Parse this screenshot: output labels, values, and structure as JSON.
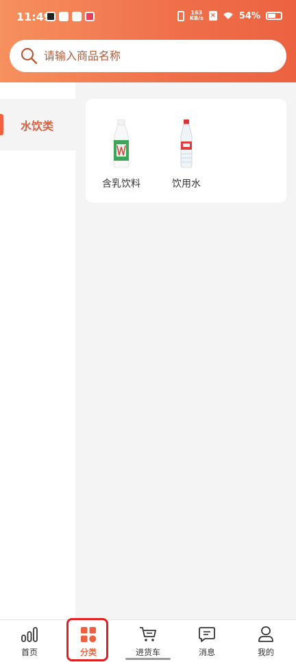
{
  "status_bar": {
    "time": "11:49",
    "network_speed_top": "163",
    "network_speed_unit": "KB/s",
    "battery_percent": "54%"
  },
  "search": {
    "placeholder": "请输入商品名称"
  },
  "sidebar": {
    "items": [
      {
        "label": "水饮类",
        "selected": true
      }
    ]
  },
  "products": [
    {
      "name": "含乳饮料",
      "icon": "milk-drink-bottle"
    },
    {
      "name": "饮用水",
      "icon": "water-bottle"
    }
  ],
  "tabbar": {
    "items": [
      {
        "label": "首页",
        "icon": "home-stats-icon"
      },
      {
        "label": "分类",
        "icon": "category-icon",
        "active": true
      },
      {
        "label": "进货车",
        "icon": "cart-icon"
      },
      {
        "label": "消息",
        "icon": "message-icon"
      },
      {
        "label": "我的",
        "icon": "user-icon"
      }
    ]
  },
  "colors": {
    "accent": "#ec6240",
    "highlight_box": "#e02020"
  }
}
